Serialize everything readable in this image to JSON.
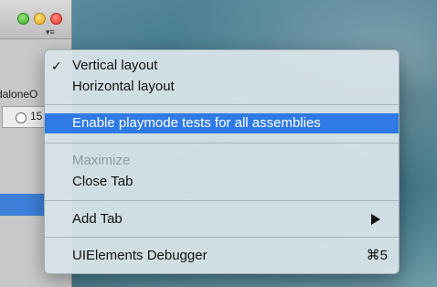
{
  "editor": {
    "window_menu_glyph": "▾≡",
    "panel_label": "daloneO",
    "radio_value": "15"
  },
  "menu": {
    "items": [
      {
        "label": "Vertical layout",
        "checked": true,
        "check_mark": "✓"
      },
      {
        "label": "Horizontal layout",
        "checked": false
      },
      {
        "label": "Enable playmode tests for all assemblies",
        "highlighted": true
      },
      {
        "label": "Maximize",
        "disabled": true
      },
      {
        "label": "Close Tab"
      },
      {
        "label": "Add Tab",
        "submenu": true
      },
      {
        "label": "UIElements Debugger",
        "shortcut": "⌘5"
      }
    ]
  },
  "colors": {
    "highlight": "#2f7ae5",
    "menu_background": "#d6e2e6",
    "disabled_text": "#8f9a9e"
  }
}
